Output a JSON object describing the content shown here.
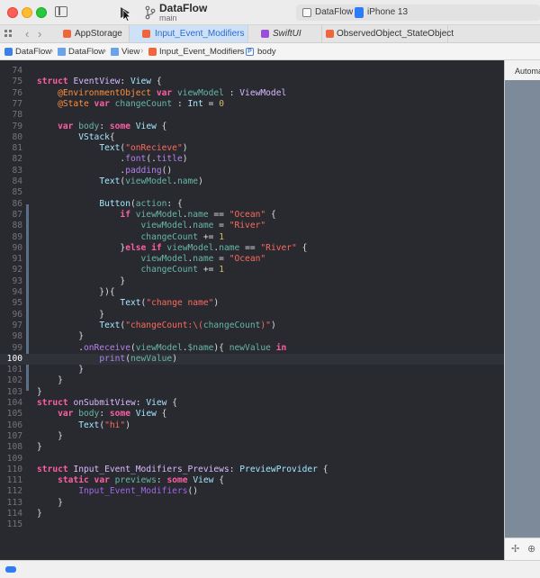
{
  "window": {
    "scheme_name": "DataFlow",
    "branch": "main",
    "destination": {
      "app": "DataFlow",
      "device": "iPhone 13"
    }
  },
  "tabs": [
    {
      "label": "AppStorage",
      "icon": "swift-file-icon",
      "active": false
    },
    {
      "label": "Input_Event_Modifiers",
      "icon": "swift-file-icon",
      "active": true
    },
    {
      "label": "SwiftUI",
      "icon": "swiftui-icon",
      "active": false
    },
    {
      "label": "ObservedObject_StateObject",
      "icon": "swift-file-icon",
      "active": false
    }
  ],
  "breadcrumb": [
    "DataFlow",
    "DataFlow",
    "View",
    "Input_Event_Modifiers",
    "body"
  ],
  "editor": {
    "current_line": 100,
    "lines": [
      {
        "n": "74",
        "t": []
      },
      {
        "n": "75",
        "t": [
          [
            "kw",
            "struct "
          ],
          [
            "ty",
            "EventView"
          ],
          [
            "pl",
            ": "
          ],
          [
            "tp",
            "View"
          ],
          [
            "pl",
            " {"
          ]
        ]
      },
      {
        "n": "76",
        "t": [
          [
            "pl",
            "    "
          ],
          [
            "at",
            "@EnvironmentObject "
          ],
          [
            "kw",
            "var "
          ],
          [
            "pr",
            "viewModel"
          ],
          [
            "pl",
            " : "
          ],
          [
            "ty",
            "ViewModel"
          ]
        ]
      },
      {
        "n": "77",
        "t": [
          [
            "pl",
            "    "
          ],
          [
            "at",
            "@State "
          ],
          [
            "kw",
            "var "
          ],
          [
            "pr",
            "changeCount"
          ],
          [
            "pl",
            " : "
          ],
          [
            "tp",
            "Int"
          ],
          [
            "pl",
            " = "
          ],
          [
            "nm",
            "0"
          ]
        ]
      },
      {
        "n": "78",
        "t": []
      },
      {
        "n": "79",
        "t": [
          [
            "pl",
            "    "
          ],
          [
            "kw",
            "var "
          ],
          [
            "pr",
            "body"
          ],
          [
            "pl",
            ": "
          ],
          [
            "kw",
            "some "
          ],
          [
            "tp",
            "View"
          ],
          [
            "pl",
            " {"
          ]
        ]
      },
      {
        "n": "80",
        "t": [
          [
            "pl",
            "        "
          ],
          [
            "tp",
            "VStack"
          ],
          [
            "pl",
            "{"
          ]
        ]
      },
      {
        "n": "81",
        "t": [
          [
            "pl",
            "            "
          ],
          [
            "tp",
            "Text"
          ],
          [
            "pl",
            "("
          ],
          [
            "st",
            "\"onRecieve\""
          ],
          [
            "pl",
            ")"
          ]
        ]
      },
      {
        "n": "82",
        "t": [
          [
            "pl",
            "                ."
          ],
          [
            "fn",
            "font"
          ],
          [
            "pl",
            "(."
          ],
          [
            "fn",
            "title"
          ],
          [
            "pl",
            ")"
          ]
        ]
      },
      {
        "n": "83",
        "t": [
          [
            "pl",
            "                ."
          ],
          [
            "fn",
            "padding"
          ],
          [
            "pl",
            "()"
          ]
        ]
      },
      {
        "n": "84",
        "t": [
          [
            "pl",
            "            "
          ],
          [
            "tp",
            "Text"
          ],
          [
            "pl",
            "("
          ],
          [
            "pr",
            "viewModel"
          ],
          [
            "pl",
            "."
          ],
          [
            "pr",
            "name"
          ],
          [
            "pl",
            ")"
          ]
        ]
      },
      {
        "n": "85",
        "t": []
      },
      {
        "n": "86",
        "t": [
          [
            "pl",
            "            "
          ],
          [
            "tp",
            "Button"
          ],
          [
            "pl",
            "("
          ],
          [
            "pr",
            "action"
          ],
          [
            "pl",
            ": {"
          ]
        ]
      },
      {
        "n": "87",
        "t": [
          [
            "pl",
            "                "
          ],
          [
            "kw",
            "if "
          ],
          [
            "pr",
            "viewModel"
          ],
          [
            "pl",
            "."
          ],
          [
            "pr",
            "name"
          ],
          [
            "pl",
            " == "
          ],
          [
            "st",
            "\"Ocean\""
          ],
          [
            "pl",
            " {"
          ]
        ]
      },
      {
        "n": "88",
        "t": [
          [
            "pl",
            "                    "
          ],
          [
            "pr",
            "viewModel"
          ],
          [
            "pl",
            "."
          ],
          [
            "pr",
            "name"
          ],
          [
            "pl",
            " = "
          ],
          [
            "st",
            "\"River\""
          ]
        ]
      },
      {
        "n": "89",
        "t": [
          [
            "pl",
            "                    "
          ],
          [
            "pr",
            "changeCount"
          ],
          [
            "pl",
            " += "
          ],
          [
            "nm",
            "1"
          ]
        ]
      },
      {
        "n": "90",
        "t": [
          [
            "pl",
            "                }"
          ],
          [
            "kw",
            "else if "
          ],
          [
            "pr",
            "viewModel"
          ],
          [
            "pl",
            "."
          ],
          [
            "pr",
            "name"
          ],
          [
            "pl",
            " == "
          ],
          [
            "st",
            "\"River\""
          ],
          [
            "pl",
            " {"
          ]
        ]
      },
      {
        "n": "91",
        "t": [
          [
            "pl",
            "                    "
          ],
          [
            "pr",
            "viewModel"
          ],
          [
            "pl",
            "."
          ],
          [
            "pr",
            "name"
          ],
          [
            "pl",
            " = "
          ],
          [
            "st",
            "\"Ocean\""
          ]
        ]
      },
      {
        "n": "92",
        "t": [
          [
            "pl",
            "                    "
          ],
          [
            "pr",
            "changeCount"
          ],
          [
            "pl",
            " += "
          ],
          [
            "nm",
            "1"
          ]
        ]
      },
      {
        "n": "93",
        "t": [
          [
            "pl",
            "                }"
          ]
        ]
      },
      {
        "n": "94",
        "t": [
          [
            "pl",
            "            }){"
          ]
        ]
      },
      {
        "n": "95",
        "t": [
          [
            "pl",
            "                "
          ],
          [
            "tp",
            "Text"
          ],
          [
            "pl",
            "("
          ],
          [
            "st",
            "\"change name\""
          ],
          [
            "pl",
            ")"
          ]
        ]
      },
      {
        "n": "96",
        "t": [
          [
            "pl",
            "            }"
          ]
        ]
      },
      {
        "n": "97",
        "t": [
          [
            "pl",
            "            "
          ],
          [
            "tp",
            "Text"
          ],
          [
            "pl",
            "("
          ],
          [
            "st",
            "\"changeCount:\\("
          ],
          [
            "pr",
            "changeCount"
          ],
          [
            "st",
            ")\""
          ],
          [
            "pl",
            ")"
          ]
        ]
      },
      {
        "n": "98",
        "t": [
          [
            "pl",
            "        }"
          ]
        ]
      },
      {
        "n": "99",
        "t": [
          [
            "pl",
            "        ."
          ],
          [
            "fn",
            "onReceive"
          ],
          [
            "pl",
            "("
          ],
          [
            "pr",
            "viewModel"
          ],
          [
            "pl",
            "."
          ],
          [
            "pr",
            "$name"
          ],
          [
            "pl",
            "){ "
          ],
          [
            "pr",
            "newValue"
          ],
          [
            "pl",
            " "
          ],
          [
            "kw",
            "in"
          ]
        ]
      },
      {
        "n": "100",
        "t": [
          [
            "pl",
            "            "
          ],
          [
            "fn",
            "print"
          ],
          [
            "pl",
            "("
          ],
          [
            "pr",
            "newValue"
          ],
          [
            "pl",
            ")"
          ]
        ]
      },
      {
        "n": "101",
        "t": [
          [
            "pl",
            "        }"
          ]
        ]
      },
      {
        "n": "102",
        "t": [
          [
            "pl",
            "    }"
          ]
        ]
      },
      {
        "n": "103",
        "t": [
          [
            "pl",
            "}"
          ]
        ]
      },
      {
        "n": "104",
        "t": [
          [
            "kw",
            "struct "
          ],
          [
            "ty",
            "onSubmitView"
          ],
          [
            "pl",
            ": "
          ],
          [
            "tp",
            "View"
          ],
          [
            "pl",
            " {"
          ]
        ]
      },
      {
        "n": "105",
        "t": [
          [
            "pl",
            "    "
          ],
          [
            "kw",
            "var "
          ],
          [
            "pr",
            "body"
          ],
          [
            "pl",
            ": "
          ],
          [
            "kw",
            "some "
          ],
          [
            "tp",
            "View"
          ],
          [
            "pl",
            " {"
          ]
        ]
      },
      {
        "n": "106",
        "t": [
          [
            "pl",
            "        "
          ],
          [
            "tp",
            "Text"
          ],
          [
            "pl",
            "("
          ],
          [
            "st",
            "\"hi\""
          ],
          [
            "pl",
            ")"
          ]
        ]
      },
      {
        "n": "107",
        "t": [
          [
            "pl",
            "    }"
          ]
        ]
      },
      {
        "n": "108",
        "t": [
          [
            "pl",
            "}"
          ]
        ]
      },
      {
        "n": "109",
        "t": []
      },
      {
        "n": "110",
        "t": [
          [
            "kw",
            "struct "
          ],
          [
            "ty",
            "Input_Event_Modifiers_Previews"
          ],
          [
            "pl",
            ": "
          ],
          [
            "tp",
            "PreviewProvider"
          ],
          [
            "pl",
            " {"
          ]
        ]
      },
      {
        "n": "111",
        "t": [
          [
            "pl",
            "    "
          ],
          [
            "kw",
            "static var "
          ],
          [
            "pr",
            "previews"
          ],
          [
            "pl",
            ": "
          ],
          [
            "kw",
            "some "
          ],
          [
            "tp",
            "View"
          ],
          [
            "pl",
            " {"
          ]
        ]
      },
      {
        "n": "112",
        "t": [
          [
            "pl",
            "        "
          ],
          [
            "id",
            "Input_Event_Modifiers"
          ],
          [
            "pl",
            "()"
          ]
        ]
      },
      {
        "n": "113",
        "t": [
          [
            "pl",
            "    }"
          ]
        ]
      },
      {
        "n": "114",
        "t": [
          [
            "pl",
            "}"
          ]
        ]
      },
      {
        "n": "115",
        "t": []
      }
    ]
  },
  "canvas": {
    "label": "Automa"
  },
  "colors": {
    "editor_bg": "#292a30",
    "keyword": "#fc5fa3",
    "string": "#fc6a5d",
    "type": "#a3e8ff",
    "accent": "#2d7cf6"
  }
}
